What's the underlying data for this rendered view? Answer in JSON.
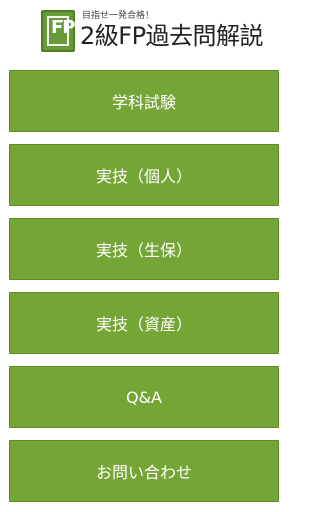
{
  "header": {
    "logo_text": "FP",
    "tagline": "目指せ一発合格！",
    "title": "2級FP過去問解説"
  },
  "menu": {
    "items": [
      {
        "label": "学科試験"
      },
      {
        "label": "実技（個人）"
      },
      {
        "label": "実技（生保）"
      },
      {
        "label": "実技（資産）"
      },
      {
        "label": "Q&A"
      },
      {
        "label": "お問い合わせ"
      }
    ]
  },
  "colors": {
    "accent": "#75a534",
    "accent_border": "#5f8c27",
    "logo": "#6a9a37"
  }
}
